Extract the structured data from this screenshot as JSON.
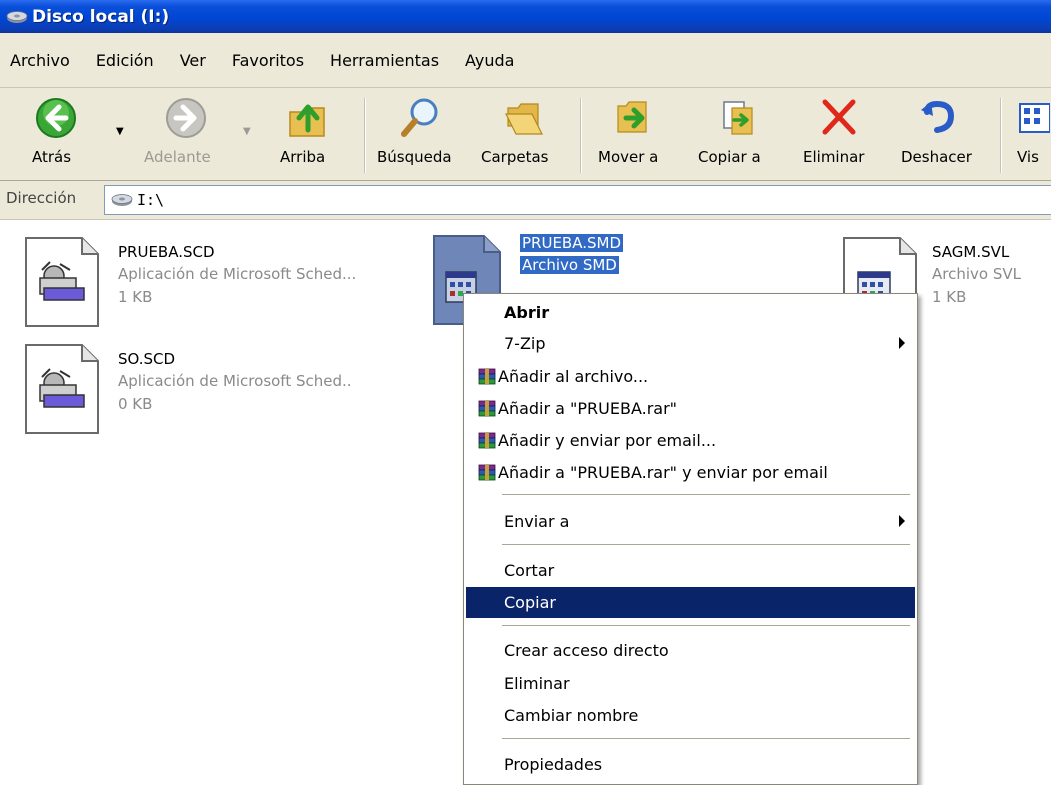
{
  "window": {
    "title": "Disco local (I:)"
  },
  "menubar": {
    "items": [
      "Archivo",
      "Edición",
      "Ver",
      "Favoritos",
      "Herramientas",
      "Ayuda"
    ]
  },
  "toolbar": {
    "back_label": "Atrás",
    "forward_label": "Adelante",
    "up_label": "Arriba",
    "search_label": "Búsqueda",
    "folders_label": "Carpetas",
    "move_label": "Mover a",
    "copy_label": "Copiar a",
    "delete_label": "Eliminar",
    "undo_label": "Deshacer",
    "views_label": "Vis"
  },
  "address": {
    "label": "Dirección",
    "value": "I:\\"
  },
  "files": [
    {
      "name": "PRUEBA.SCD",
      "type": "Aplicación de Microsoft Sched...",
      "size": "1 KB"
    },
    {
      "name": "SO.SCD",
      "type": "Aplicación de Microsoft Sched..",
      "size": "0 KB"
    },
    {
      "name": "PRUEBA.SMD",
      "type": "Archivo SMD",
      "size": ""
    },
    {
      "name": "SAGM.SVL",
      "type": "Archivo SVL",
      "size": "1 KB"
    }
  ],
  "context_menu": {
    "items": [
      {
        "label": "Abrir"
      },
      {
        "label": "7-Zip"
      },
      {
        "label": "Añadir al archivo..."
      },
      {
        "label": "Añadir a \"PRUEBA.rar\""
      },
      {
        "label": "Añadir y enviar por email..."
      },
      {
        "label": "Añadir a \"PRUEBA.rar\" y enviar por email"
      },
      {
        "label": "Enviar a"
      },
      {
        "label": "Cortar"
      },
      {
        "label": "Copiar"
      },
      {
        "label": "Crear acceso directo"
      },
      {
        "label": "Eliminar"
      },
      {
        "label": "Cambiar nombre"
      },
      {
        "label": "Propiedades"
      }
    ],
    "highlighted": "Copiar"
  },
  "colors": {
    "titlebar": "#0046d5",
    "chrome": "#ece9d8",
    "selection": "#316ac5",
    "menu_highlight": "#0a246a"
  }
}
